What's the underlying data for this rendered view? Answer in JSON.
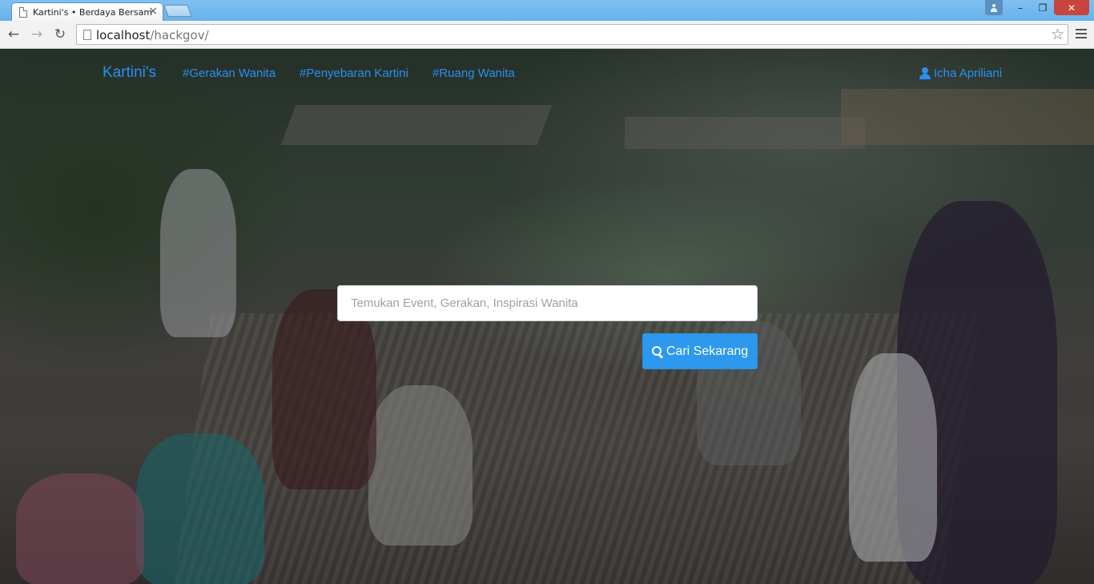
{
  "browser": {
    "tab_title": "Kartini's • Berdaya Bersam",
    "tab_close": "×",
    "url_host": "localhost",
    "url_path": "/hackgov/",
    "back_glyph": "←",
    "forward_glyph": "→",
    "reload_glyph": "↻",
    "bookmark_glyph": "☆",
    "window_minimize": "–",
    "window_restore": "❐",
    "window_close": "✕"
  },
  "navbar": {
    "brand": "Kartini's",
    "links": [
      {
        "label": "#Gerakan Wanita"
      },
      {
        "label": "#Penyebaran Kartini"
      },
      {
        "label": "#Ruang Wanita"
      }
    ],
    "user": {
      "name": "Icha Apriliani",
      "icon": "user-icon"
    }
  },
  "search": {
    "placeholder": "Temukan Event, Gerakan, Inspirasi Wanita",
    "value": "",
    "button_label": "Cari Sekarang",
    "button_icon": "search-icon"
  },
  "colors": {
    "link": "#2a8ff0",
    "button": "#2c99ee",
    "titlebar": "#7fc0f2"
  }
}
